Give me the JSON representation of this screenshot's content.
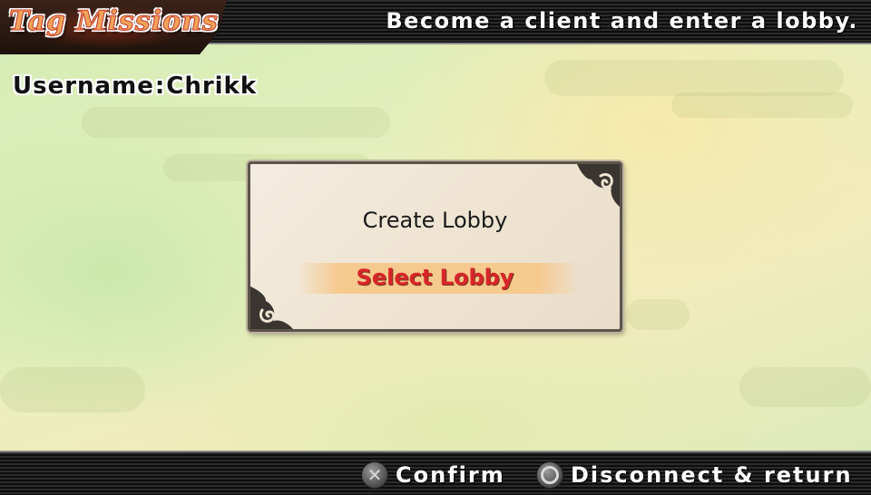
{
  "header": {
    "title": "Tag Missions",
    "hint": "Become a client and enter a lobby."
  },
  "user": {
    "label": "Username",
    "separator": ":",
    "name": "Chrikk"
  },
  "dialog": {
    "options": [
      {
        "label": "Create Lobby",
        "selected": false
      },
      {
        "label": "Select Lobby",
        "selected": true
      }
    ]
  },
  "footer": {
    "confirm": {
      "icon": "cross-button-icon",
      "label": "Confirm"
    },
    "back": {
      "icon": "circle-button-icon",
      "label": "Disconnect & return"
    }
  },
  "colors": {
    "selected_text": "#d8252a",
    "title_text": "#f3a25a",
    "bar": "#111111"
  }
}
